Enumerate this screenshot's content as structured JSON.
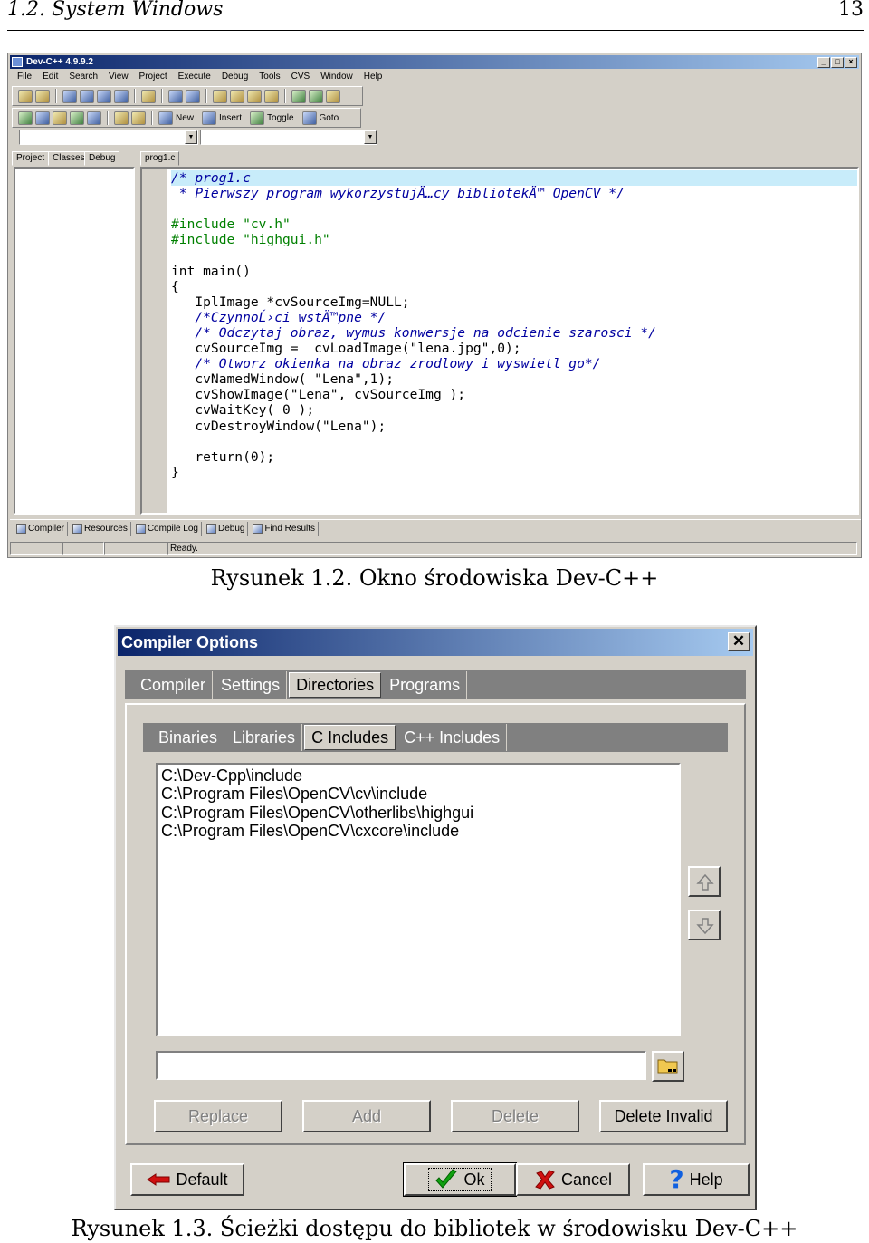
{
  "page_header": {
    "left": "1.2. System Windows",
    "right": "13"
  },
  "devcpp": {
    "title": "Dev-C++ 4.9.9.2",
    "menu": [
      "File",
      "Edit",
      "Search",
      "View",
      "Project",
      "Execute",
      "Debug",
      "Tools",
      "CVS",
      "Window",
      "Help"
    ],
    "toolbar_labels": [
      "New",
      "Insert",
      "Toggle",
      "Goto"
    ],
    "panel_tabs": [
      "Project",
      "Classes",
      "Debug"
    ],
    "editor_tab": "prog1.c",
    "code": [
      "/* prog1.c",
      " * Pierwszy program wykorzystujÄ…cy bibliotekÄ™ OpenCV */",
      "",
      "#include \"cv.h\"",
      "#include \"highgui.h\"",
      "",
      "int main()",
      "{",
      "   IplImage *cvSourceImg=NULL;",
      "   /*CzynnoĹ›ci wstÄ™pne */",
      "   /* Odczytaj obraz, wymus konwersje na odcienie szarosci */",
      "   cvSourceImg =  cvLoadImage(\"lena.jpg\",0);",
      "   /* Otworz okienka na obraz zrodlowy i wyswietl go*/",
      "   cvNamedWindow( \"Lena\",1);",
      "   cvShowImage(\"Lena\", cvSourceImg );",
      "   cvWaitKey( 0 );",
      "   cvDestroyWindow(\"Lena\");",
      "",
      "   return(0);",
      "}"
    ],
    "bottom_tabs": [
      "Compiler",
      "Resources",
      "Compile Log",
      "Debug",
      "Find Results"
    ],
    "status": "Ready."
  },
  "caption1": "Rysunek 1.2.  Okno środowiska Dev-C++",
  "dialog": {
    "title": "Compiler Options",
    "close": "✕",
    "tabs": [
      "Compiler",
      "Settings",
      "Directories",
      "Programs"
    ],
    "selected_tab": "Directories",
    "subtabs": [
      "Binaries",
      "Libraries",
      "C Includes",
      "C++ Includes"
    ],
    "selected_subtab": "C Includes",
    "dirs": [
      "C:\\Dev-Cpp\\include",
      "C:\\Program Files\\OpenCV\\cv\\include",
      "C:\\Program Files\\OpenCV\\otherlibs\\highgui",
      "C:\\Program Files\\OpenCV\\cxcore\\include"
    ],
    "path_value": "",
    "buttons": {
      "replace": "Replace",
      "add": "Add",
      "delete": "Delete",
      "delete_invalid": "Delete Invalid",
      "default": "Default",
      "ok": "Ok",
      "cancel": "Cancel",
      "help": "Help"
    }
  },
  "caption2": "Rysunek 1.3.  Ścieżki dostępu do bibliotek w środowisku Dev-C++"
}
